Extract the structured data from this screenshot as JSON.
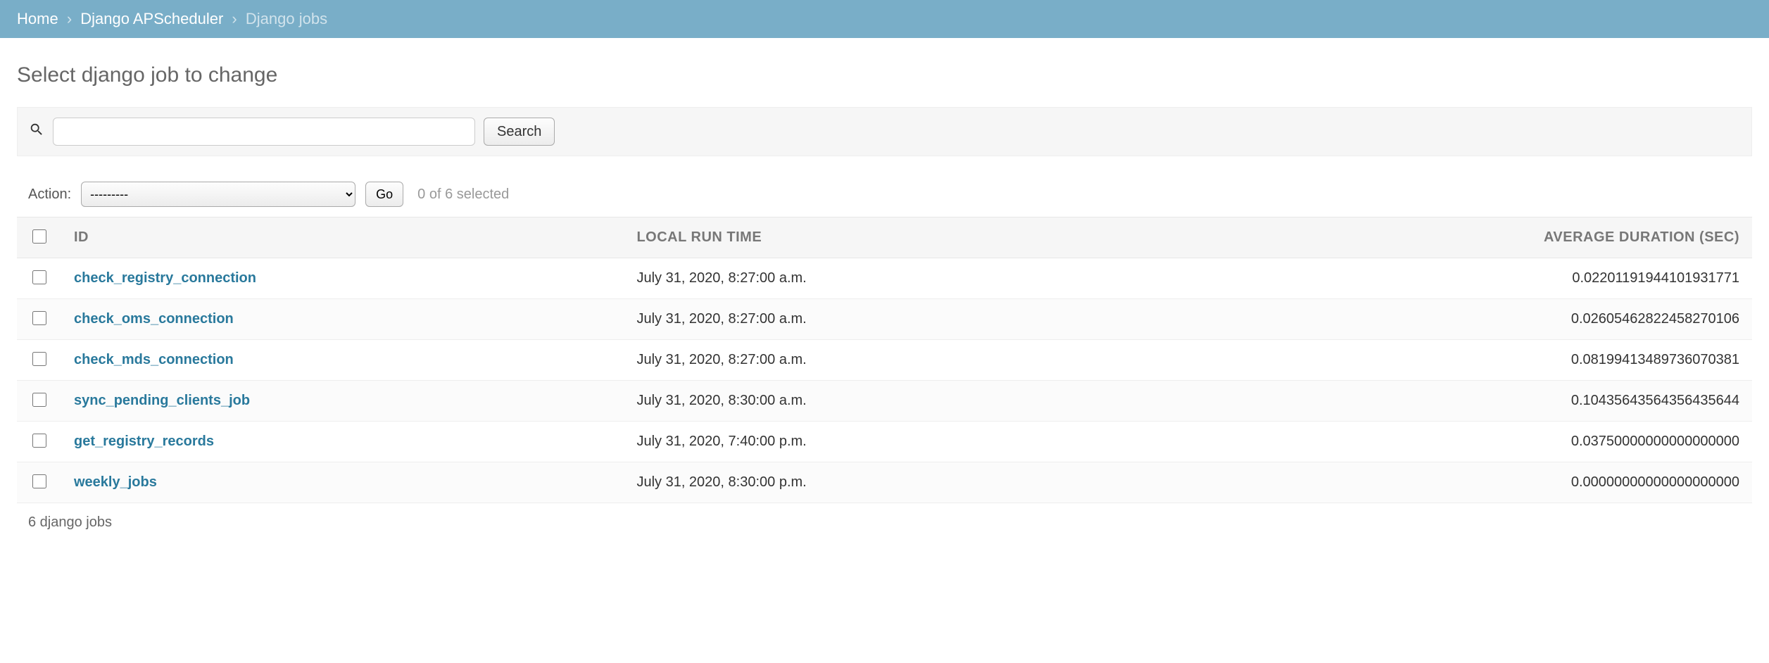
{
  "breadcrumb": {
    "home": "Home",
    "app": "Django APScheduler",
    "current": "Django jobs"
  },
  "page_title": "Select django job to change",
  "search": {
    "button_label": "Search",
    "value": ""
  },
  "actions": {
    "label": "Action:",
    "placeholder_option": "---------",
    "go_label": "Go",
    "selection_text": "0 of 6 selected"
  },
  "table": {
    "headers": {
      "id": "ID",
      "local_run_time": "LOCAL RUN TIME",
      "avg_duration": "AVERAGE DURATION (SEC)"
    },
    "rows": [
      {
        "id": "check_registry_connection",
        "local_run_time": "July 31, 2020, 8:27:00 a.m.",
        "avg_duration": "0.02201191944101931771"
      },
      {
        "id": "check_oms_connection",
        "local_run_time": "July 31, 2020, 8:27:00 a.m.",
        "avg_duration": "0.02605462822458270106"
      },
      {
        "id": "check_mds_connection",
        "local_run_time": "July 31, 2020, 8:27:00 a.m.",
        "avg_duration": "0.08199413489736070381"
      },
      {
        "id": "sync_pending_clients_job",
        "local_run_time": "July 31, 2020, 8:30:00 a.m.",
        "avg_duration": "0.10435643564356435644"
      },
      {
        "id": "get_registry_records",
        "local_run_time": "July 31, 2020, 7:40:00 p.m.",
        "avg_duration": "0.03750000000000000000"
      },
      {
        "id": "weekly_jobs",
        "local_run_time": "July 31, 2020, 8:30:00 p.m.",
        "avg_duration": "0.00000000000000000000"
      }
    ]
  },
  "paginator": {
    "count_text": "6 django jobs"
  }
}
